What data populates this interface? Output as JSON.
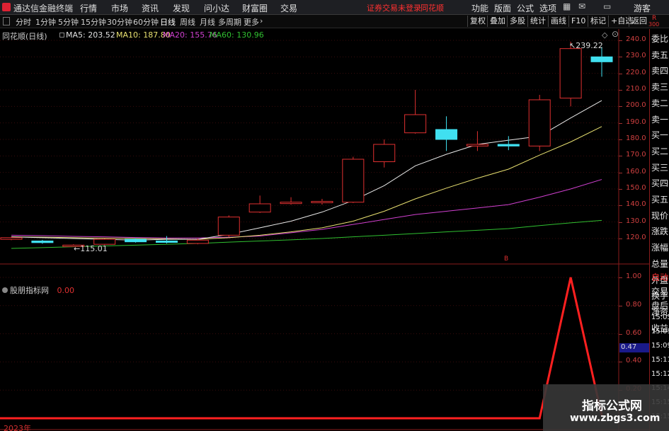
{
  "titlebar": {
    "app_name": "通达信金融终端",
    "menus": [
      "行情",
      "市场",
      "资讯",
      "发现",
      "问小达",
      "财富圈",
      "交易"
    ],
    "login_status": "证券交易未登录",
    "brand": "同花顺",
    "right_menus": [
      "功能",
      "版面",
      "公式",
      "选项"
    ],
    "guest": "游客"
  },
  "toolbar": {
    "periods": [
      "分时",
      "1分钟",
      "5分钟",
      "15分钟",
      "30分钟",
      "60分钟",
      "日线",
      "周线",
      "月线",
      "多周期",
      "更多"
    ],
    "active_period": "日线",
    "buttons": [
      "复权",
      "叠加",
      "多股",
      "统计",
      "画线",
      "F10",
      "标记",
      "+自选",
      "返回"
    ]
  },
  "stock": {
    "name": "同花顺(日线)",
    "ma5": "MA5: 203.52",
    "ma10": "MA10: 187.80",
    "ma20": "MA20: 155.76",
    "ma60": "MA60: 130.96",
    "high_label": "239.22",
    "low_label": "115.01",
    "marker": "B",
    "colors": {
      "ma5": "#e8e8e8",
      "ma10": "#e8e070",
      "ma20": "#d040d0",
      "ma60": "#30c030",
      "up": "#e03030",
      "down": "#40e0f0"
    }
  },
  "price_axis": {
    "labels": [
      "240.0",
      "230.0",
      "220.0",
      "210.0",
      "200.0",
      "190.0",
      "180.0",
      "170.0",
      "160.0",
      "150.0",
      "140.0",
      "130.0",
      "120.0"
    ],
    "ticks": [
      240,
      230,
      220,
      210,
      200,
      190,
      180,
      170,
      160,
      150,
      140,
      130,
      120
    ]
  },
  "indicator": {
    "name": "股朋指标网",
    "value": "0.00",
    "axis_labels": [
      "1.00",
      "0.80",
      "0.60",
      "0.40",
      "0.20"
    ],
    "ticks": [
      1.0,
      0.8,
      0.6,
      0.4,
      0.2
    ],
    "current": "0.47",
    "year": "2023年"
  },
  "right_panel": {
    "items": [
      "委比",
      "卖五",
      "卖四",
      "卖三",
      "卖二",
      "卖一",
      "买一",
      "买二",
      "买三",
      "买四",
      "买五",
      "现价",
      "涨跌",
      "涨幅",
      "总量",
      "外盘",
      "换手",
      "净资",
      "收益",
      "自动",
      "交易",
      "盘后",
      "15:05",
      "15:09",
      "15:09",
      "15:11",
      "15:12",
      "15:14",
      "15:15",
      "15:15"
    ],
    "badge": "R",
    "badge_num": "300"
  },
  "watermark": {
    "title": "指标公式网",
    "url": "www.zbgs3.com"
  },
  "chart_data": {
    "type": "candlestick",
    "candles": [
      {
        "o": 119.5,
        "c": 120.5,
        "h": 121.0,
        "l": 119.0
      },
      {
        "o": 118.5,
        "c": 117.5,
        "h": 119.2,
        "l": 116.8
      },
      {
        "o": 116.0,
        "c": 116.0,
        "h": 116.5,
        "l": 115.0
      },
      {
        "o": 116.5,
        "c": 119.5,
        "h": 120.0,
        "l": 116.0
      },
      {
        "o": 119.5,
        "c": 118.0,
        "h": 120.2,
        "l": 117.5
      },
      {
        "o": 118.5,
        "c": 118.0,
        "h": 121.5,
        "l": 117.0
      },
      {
        "o": 117.0,
        "c": 119.0,
        "h": 120.0,
        "l": 116.5
      },
      {
        "o": 122.0,
        "c": 133.0,
        "h": 134.0,
        "l": 121.0
      },
      {
        "o": 136.0,
        "c": 141.0,
        "h": 146.0,
        "l": 135.5
      },
      {
        "o": 142.0,
        "c": 142.0,
        "h": 145.0,
        "l": 140.5
      },
      {
        "o": 142.0,
        "c": 142.5,
        "h": 144.0,
        "l": 140.5
      },
      {
        "o": 142.0,
        "c": 168.0,
        "h": 169.5,
        "l": 141.5
      },
      {
        "o": 166.5,
        "c": 177.0,
        "h": 180.0,
        "l": 163.0
      },
      {
        "o": 184.0,
        "c": 195.0,
        "h": 210.0,
        "l": 183.5
      },
      {
        "o": 186.0,
        "c": 180.0,
        "h": 194.0,
        "l": 173.0
      },
      {
        "o": 176.0,
        "c": 177.0,
        "h": 185.0,
        "l": 173.0
      },
      {
        "o": 177.0,
        "c": 176.0,
        "h": 182.0,
        "l": 173.5
      },
      {
        "o": 176.0,
        "c": 204.0,
        "h": 207.0,
        "l": 173.0
      },
      {
        "o": 205.0,
        "c": 235.0,
        "h": 239.22,
        "l": 200.0
      },
      {
        "o": 230.0,
        "c": 227.0,
        "h": 236.0,
        "l": 218.0
      }
    ],
    "ma5": [
      121,
      120.5,
      120,
      119.5,
      119,
      119.5,
      119.5,
      122.5,
      126.5,
      130.5,
      136,
      143,
      152,
      164,
      171,
      177,
      179.5,
      182,
      193,
      203.52
    ],
    "ma10": [
      121,
      120.8,
      120.5,
      120.2,
      120,
      119.8,
      119.5,
      120.5,
      122,
      124,
      126.5,
      130.5,
      136.5,
      144,
      150.5,
      156.5,
      162,
      170.5,
      178.5,
      187.8
    ],
    "ma20": [
      122,
      121.7,
      121.3,
      121,
      120.6,
      120.3,
      120.3,
      120.8,
      121.5,
      123.5,
      125.5,
      128.5,
      131.5,
      134.5,
      136.5,
      138.5,
      140.5,
      145,
      150,
      155.76
    ],
    "ma60": [
      114,
      114.5,
      115,
      115.5,
      116,
      116.5,
      117,
      117.8,
      118.5,
      119.2,
      120,
      121,
      122,
      123,
      124,
      125,
      126,
      127.8,
      129.5,
      130.96
    ],
    "ylim": [
      115,
      240
    ],
    "indicator_series": [
      0,
      0,
      0,
      0,
      0,
      0,
      0,
      0,
      0,
      0,
      0,
      0,
      0,
      0,
      0,
      0,
      0,
      0,
      1.0,
      0.02
    ],
    "indicator_ylim": [
      0,
      1.0
    ]
  }
}
